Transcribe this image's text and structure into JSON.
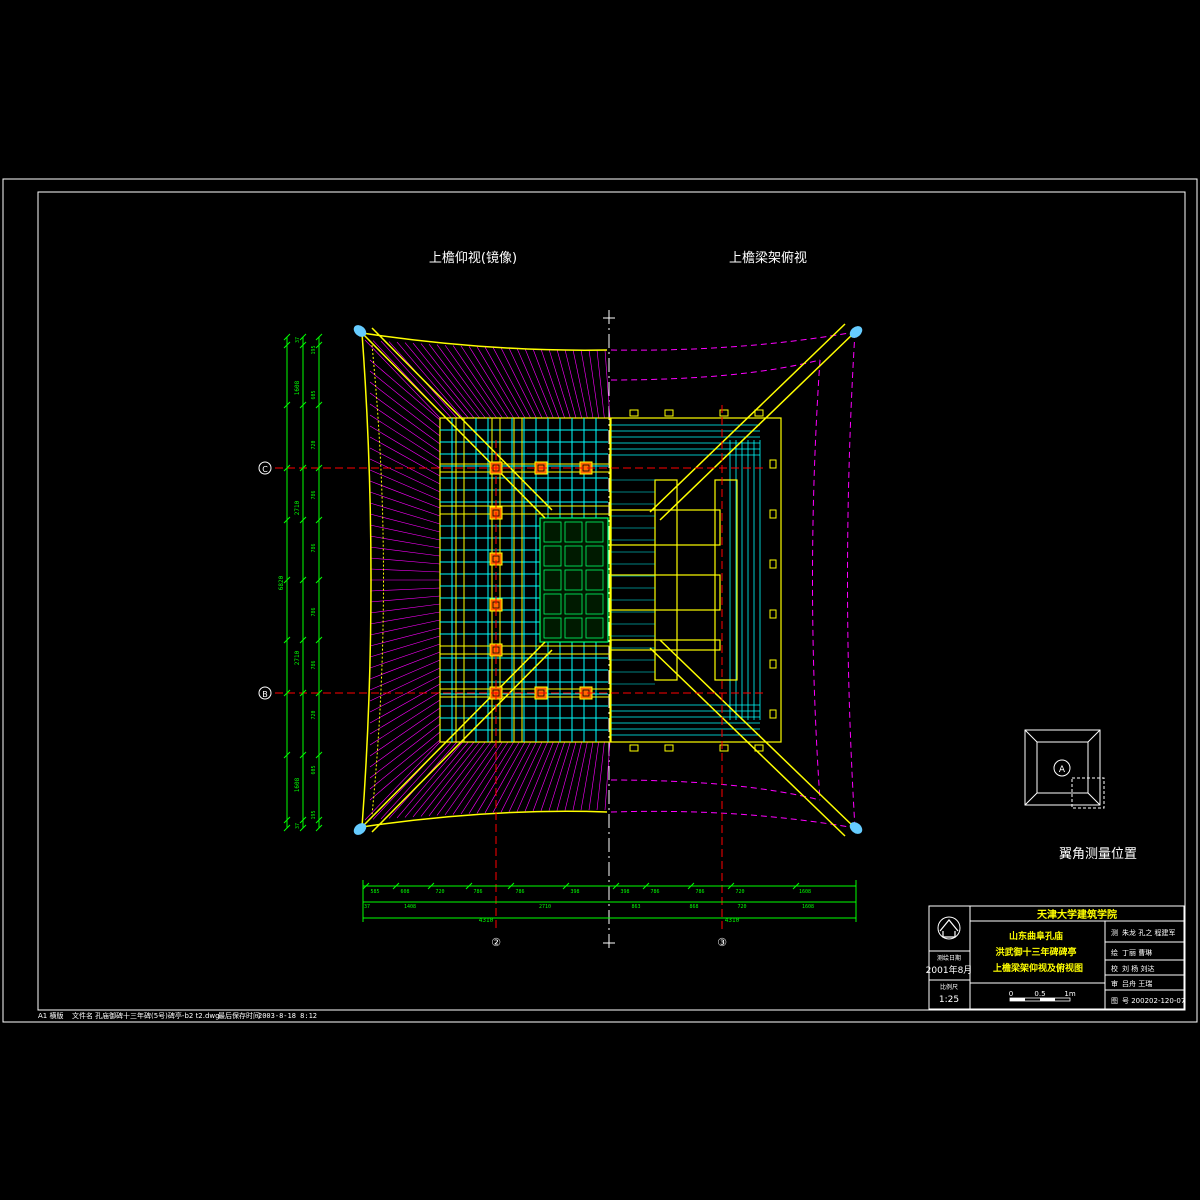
{
  "titles": {
    "left_view": "上檐仰视(镜像)",
    "right_view": "上檐梁架俯视",
    "corner_label": "翼角测量位置"
  },
  "axes": {
    "c": "C",
    "b": "B",
    "two": "②",
    "three": "③"
  },
  "vertical_dims": {
    "outer": [
      "37",
      "1608",
      "2710",
      "1608",
      "37"
    ],
    "middle": [
      "200",
      "1408",
      "200"
    ],
    "inner": [
      "195",
      "605",
      "720",
      "786",
      "786",
      "786",
      "786",
      "720",
      "605",
      "195"
    ],
    "total": "6820"
  },
  "horizontal_dims": {
    "row1": [
      "585",
      "608",
      "720",
      "786",
      "786",
      "398",
      "398",
      "786",
      "786",
      "720",
      "1608"
    ],
    "row2": [
      "37",
      "1408",
      "2710",
      "863",
      "868",
      "720",
      "1608"
    ],
    "row3": [
      "4310",
      "4310"
    ]
  },
  "key_plan": {
    "marker": "A"
  },
  "title_block": {
    "school": "天津大学建筑学院",
    "project_line1": "山东曲阜孔庙",
    "project_line2": "洪武御十三年碑碑亭",
    "sheet_title": "上檐梁架仰视及俯视图",
    "date_label": "测绘日期",
    "date_value": "2001年8月",
    "scale_label": "比例尺",
    "scale_value": "1:25",
    "scale_bar": [
      "0",
      "0.5",
      "1m"
    ],
    "roles": [
      {
        "label": "测",
        "value": "朱龙 孔之 程建军"
      },
      {
        "label": "绘",
        "value": "丁丽 曹琳"
      },
      {
        "label": "校",
        "value": "刘 杨 刘达"
      },
      {
        "label": "审",
        "value": "吕舟 王瑞"
      },
      {
        "label": "图",
        "value": "号 200202-120-07"
      }
    ]
  },
  "status_bar": {
    "size": "A1 横版",
    "file_label": "文件名",
    "file": "孔庙御碑十三年碑(5号)碑亭-b2 t2.dwg",
    "plot_label": "最后保存时间",
    "datetime": "2003-8-18 8:12"
  },
  "colors": {
    "background": "#000000",
    "frame": "#ffffff",
    "structure": "#ffff00",
    "rafters": "#ff00ff",
    "grid": "#00ffff",
    "ceiling": "#00ff66",
    "dimension": "#00ff00",
    "axis": "#ff0000",
    "text": "#ffffff",
    "corner_cap": "#66ccff",
    "bracket": "#ff6600",
    "school": "#ffff00",
    "project": "#ffff00"
  }
}
